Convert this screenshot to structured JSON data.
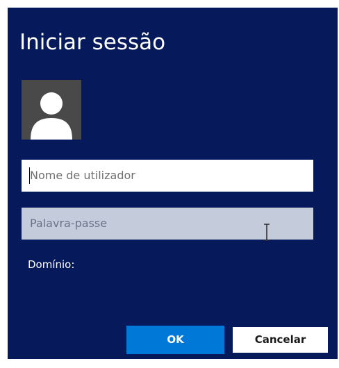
{
  "dialog": {
    "title": "Iniciar sessão",
    "avatar_icon": "user-silhouette-icon",
    "username_field": {
      "value": "",
      "placeholder": "Nome de utilizador"
    },
    "password_field": {
      "value": "",
      "placeholder": "Palavra-passe"
    },
    "domain_label": "Domínio:",
    "buttons": {
      "ok_label": "OK",
      "cancel_label": "Cancelar"
    }
  },
  "colors": {
    "dialog_background": "#06195a",
    "avatar_background": "#494949",
    "password_field_background": "#c4ccdc",
    "primary_button": "#0078d7",
    "text_light": "#ffffff"
  }
}
